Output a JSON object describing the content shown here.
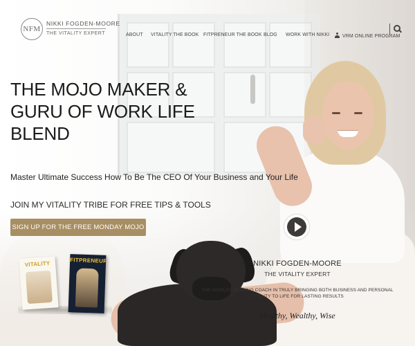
{
  "header": {
    "logo_monogram": "NFM",
    "logo_name": "NIKKI FOGDEN-MOORE",
    "logo_tagline": "THE VITALITY EXPERT",
    "nav": [
      {
        "label": "ABOUT"
      },
      {
        "label": "VITALITY THE BOOK"
      },
      {
        "label": "FITPRENEUR THE BOOK"
      },
      {
        "label": "BLOG"
      },
      {
        "label": "WORK WITH NIKKI"
      },
      {
        "label": "VRM ONLINE PROGRAM",
        "icon": "user-icon"
      }
    ],
    "search_icon": "search-icon"
  },
  "hero": {
    "headline": [
      "THE MOJO MAKER &",
      "GURU OF WORK LIFE",
      "BLEND"
    ],
    "subheadline": "Master Ultimate Success How To Be The CEO Of Your Business and Your Life",
    "join_text": "JOIN MY VITALITY TRIBE FOR FREE TIPS & TOOLS",
    "cta_label": "SIGN UP FOR THE FREE MONDAY MOJO",
    "play_icon": "play-icon"
  },
  "bio": {
    "name": "NIKKI FOGDEN-MOORE",
    "title": "THE VITALITY EXPERT",
    "description": "THE WORLDS LEADING COACH IN TRULY BRINGING BOTH BUSINESS AND PERSONAL VITALITY TO LIFE FOR LASTING RESULTS",
    "tagline": "Healthy, Wealthy, Wise"
  },
  "books": [
    {
      "title": "VITALITY"
    },
    {
      "title": "FITPRENEUR"
    }
  ],
  "colors": {
    "cta_background": "#a88e63",
    "cta_text": "#ffffff",
    "heading_text": "#1a1a1a"
  }
}
